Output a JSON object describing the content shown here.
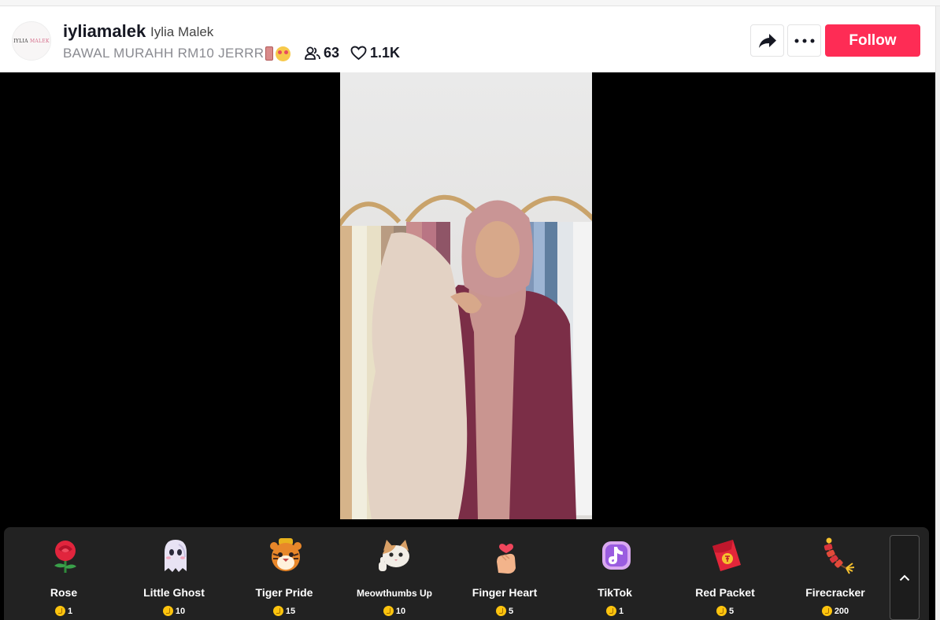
{
  "header": {
    "avatar_text_a": "IYLIA",
    "avatar_text_b": "MALEK",
    "username": "iyliamalek",
    "display_name": "Iylia Malek",
    "live_title": "BAWAL MURAHH RM10 JERRR",
    "viewer_count": "63",
    "like_count": "1.1K",
    "follow_label": "Follow"
  },
  "colors": {
    "follow": "#fe2c55",
    "panel": "#222222",
    "coin": "#fec40e"
  },
  "gifts": [
    {
      "name": "Rose",
      "price": "1",
      "icon": "rose-icon"
    },
    {
      "name": "Little Ghost",
      "price": "10",
      "icon": "ghost-icon"
    },
    {
      "name": "Tiger Pride",
      "price": "15",
      "icon": "tiger-icon"
    },
    {
      "name": "Meowthumbs Up",
      "price": "10",
      "icon": "cat-icon"
    },
    {
      "name": "Finger Heart",
      "price": "5",
      "icon": "finger-heart-icon"
    },
    {
      "name": "TikTok",
      "price": "1",
      "icon": "tiktok-icon"
    },
    {
      "name": "Red Packet",
      "price": "5",
      "icon": "red-packet-icon"
    },
    {
      "name": "Firecracker",
      "price": "200",
      "icon": "firecracker-icon"
    }
  ]
}
